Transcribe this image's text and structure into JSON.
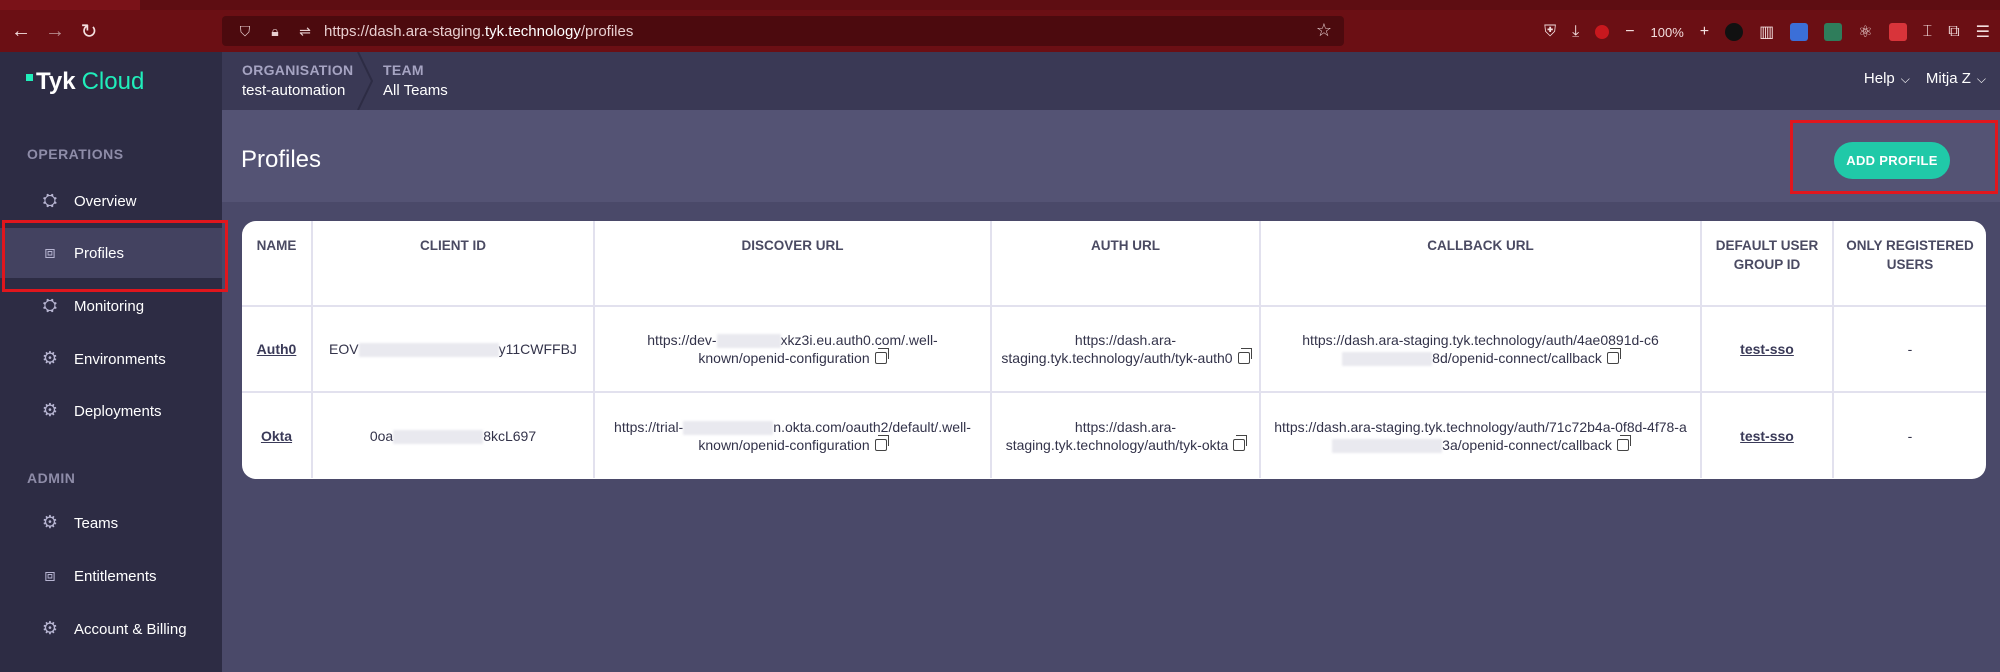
{
  "browser": {
    "url_prefix": "https://dash.ara-staging.",
    "url_host": "tyk.technology",
    "url_path": "/profiles",
    "zoom": "100%"
  },
  "sidebar": {
    "logo_tyk": "Tyk",
    "logo_cloud": "Cloud",
    "sections": [
      {
        "label": "OPERATIONS"
      },
      {
        "label": "ADMIN"
      }
    ],
    "items": [
      {
        "label": "Overview",
        "icon": "overview-icon"
      },
      {
        "label": "Profiles",
        "icon": "profiles-icon"
      },
      {
        "label": "Monitoring",
        "icon": "monitoring-icon"
      },
      {
        "label": "Environments",
        "icon": "environments-icon"
      },
      {
        "label": "Deployments",
        "icon": "deployments-icon"
      },
      {
        "label": "Teams",
        "icon": "teams-icon"
      },
      {
        "label": "Entitlements",
        "icon": "entitlements-icon"
      },
      {
        "label": "Account & Billing",
        "icon": "billing-icon"
      }
    ]
  },
  "topbar": {
    "org_label": "ORGANISATION",
    "org_value": "test-automation",
    "team_label": "TEAM",
    "team_value": "All Teams",
    "help": "Help",
    "user": "Mitja Z"
  },
  "page": {
    "title": "Profiles",
    "add_button": "ADD PROFILE"
  },
  "table": {
    "headers": [
      "NAME",
      "CLIENT ID",
      "DISCOVER URL",
      "AUTH URL",
      "CALLBACK URL",
      "DEFAULT USER GROUP ID",
      "ONLY REGISTERED USERS"
    ],
    "rows": [
      {
        "name": "Auth0",
        "client_id_a": "EOV",
        "client_id_b": "y11CWFFBJ",
        "discover_a": "https://dev-",
        "discover_b": "xkz3i.eu.auth0.com/.well-known/openid-configuration",
        "auth_url": "https://dash.ara-staging.tyk.technology/auth/tyk-auth0",
        "callback_a": "https://dash.ara-staging.tyk.technology/auth/4ae0891d-c6",
        "callback_b": "8d/openid-connect/callback",
        "group": "test-sso",
        "registered": "-"
      },
      {
        "name": "Okta",
        "client_id_a": "0oa",
        "client_id_b": "8kcL697",
        "discover_a": "https://trial-",
        "discover_b": "n.okta.com/oauth2/default/.well-known/openid-configuration",
        "auth_url": "https://dash.ara-staging.tyk.technology/auth/tyk-okta",
        "callback_a": "https://dash.ara-staging.tyk.technology/auth/71c72b4a-0f8d-4f78-a",
        "callback_b": "3a/openid-connect/callback",
        "group": "test-sso",
        "registered": "-"
      }
    ]
  }
}
